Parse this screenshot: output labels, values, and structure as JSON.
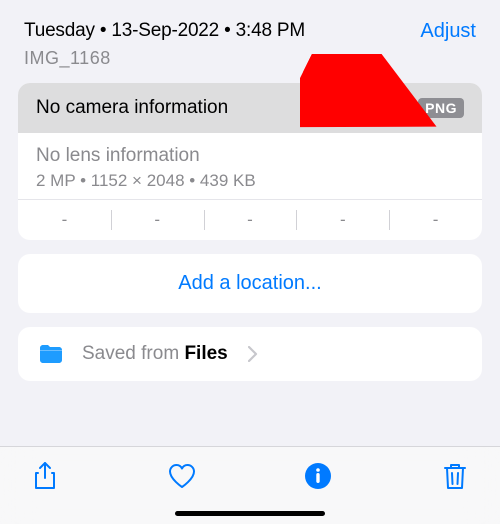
{
  "header": {
    "date_line": "Tuesday • 13-Sep-2022 • 3:48 PM",
    "filename": "IMG_1168",
    "adjust_label": "Adjust"
  },
  "camera_card": {
    "no_camera": "No camera information",
    "format_badge": "PNG",
    "no_lens": "No lens information",
    "dimensions": "2 MP  •  1152 × 2048  •  439 KB",
    "dashes": [
      "-",
      "-",
      "-",
      "-",
      "-"
    ]
  },
  "location": {
    "link": "Add a location..."
  },
  "saved": {
    "prefix": "Saved from ",
    "app": "Files"
  }
}
